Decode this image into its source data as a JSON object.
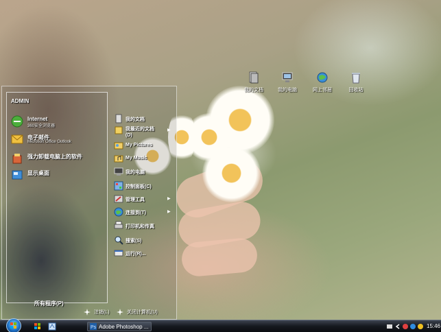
{
  "desktop": {
    "icons": [
      {
        "label": "我的文档",
        "icon": "documents-icon"
      },
      {
        "label": "我的电脑",
        "icon": "computer-icon"
      },
      {
        "label": "网上邻居",
        "icon": "network-icon"
      },
      {
        "label": "回收站",
        "icon": "recycle-bin-icon"
      }
    ]
  },
  "start_menu": {
    "user": "ADMIN",
    "pinned": [
      {
        "title": "Internet",
        "subtitle": "360安全浏览器",
        "icon": "browser-icon"
      },
      {
        "title": "电子邮件",
        "subtitle": "Microsoft Office Outlook",
        "icon": "email-icon"
      },
      {
        "title": "强力卸载电脑上的软件",
        "subtitle": "",
        "icon": "uninstall-icon"
      },
      {
        "title": "显示桌面",
        "subtitle": "",
        "icon": "show-desktop-icon"
      }
    ],
    "all_programs": "所有程序(P)",
    "right_items": [
      {
        "label": "我的文档",
        "icon": "documents-icon",
        "submenu": false
      },
      {
        "label": "我最近的文档",
        "label2": "(D)",
        "icon": "recent-docs-icon",
        "submenu": true
      },
      {
        "label": "My Pictures",
        "icon": "pictures-icon",
        "submenu": false
      },
      {
        "label": "My Music",
        "icon": "music-icon",
        "submenu": false
      },
      {
        "label": "我的电脑",
        "icon": "computer-icon",
        "submenu": false
      },
      {
        "label": "控制面板(C)",
        "icon": "control-panel-icon",
        "submenu": false
      },
      {
        "label": "管理工具",
        "icon": "admin-tools-icon",
        "submenu": true
      },
      {
        "label": "连接到(T)",
        "icon": "connect-icon",
        "submenu": true
      },
      {
        "label": "打印机和传真",
        "icon": "printer-icon",
        "submenu": false
      },
      {
        "label": "搜索(S)",
        "icon": "search-icon",
        "submenu": false
      },
      {
        "label": "运行(R)...",
        "icon": "run-icon",
        "submenu": false
      }
    ],
    "logoff": "注销(L)",
    "shutdown": "关闭计算机(U)"
  },
  "taskbar": {
    "task_label": "Adobe Photoshop ...",
    "clock": "15:46"
  },
  "colors": {
    "accent_blue": "#1c6fc6",
    "taskbar": "#16191f"
  }
}
